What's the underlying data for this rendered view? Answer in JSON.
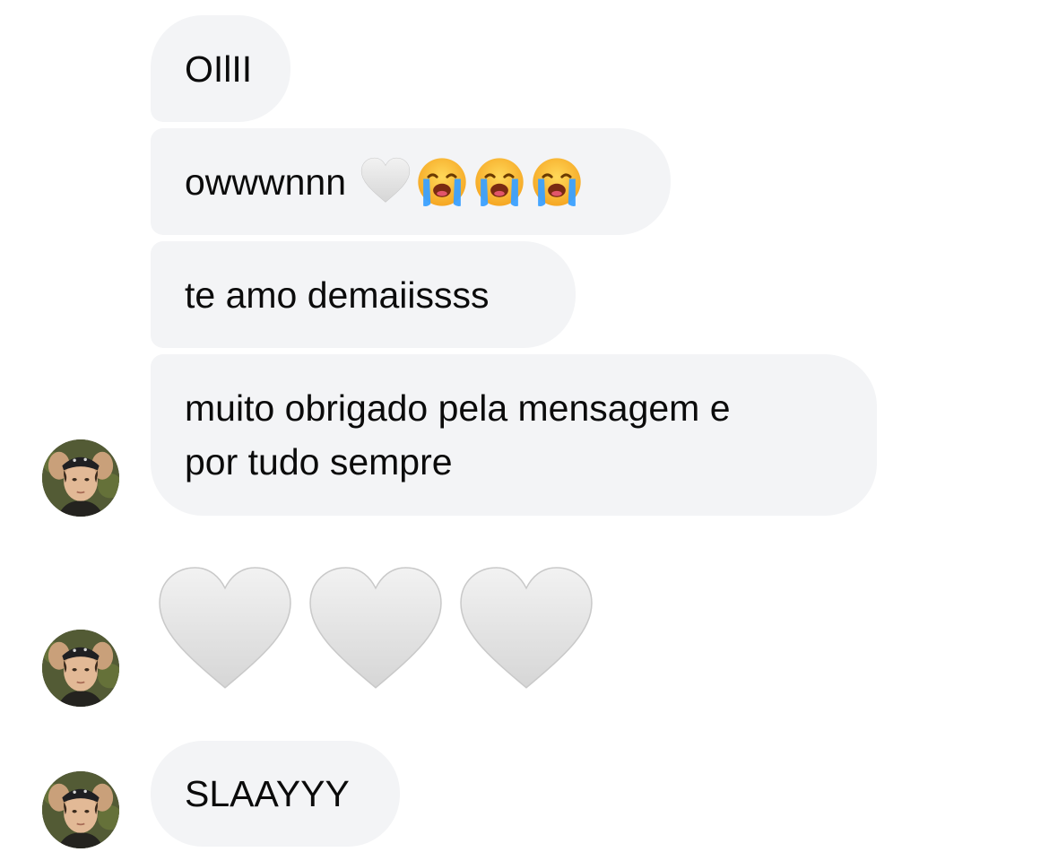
{
  "messages": [
    {
      "id": "msg-1",
      "text": "OIlII"
    },
    {
      "id": "msg-2",
      "text": "owwwnnn",
      "emojis": [
        "white-heart",
        "loudly-crying-face",
        "loudly-crying-face",
        "loudly-crying-face"
      ]
    },
    {
      "id": "msg-3",
      "text": "te amo demaiissss"
    },
    {
      "id": "msg-4",
      "line1": "muito obrigado pela mensagem e",
      "line2": "por tudo sempre"
    },
    {
      "id": "msg-5",
      "emojis": [
        "white-heart",
        "white-heart",
        "white-heart"
      ]
    },
    {
      "id": "msg-6",
      "text": "SLAAYYY"
    }
  ],
  "colors": {
    "bubble_bg": "#f3f4f6",
    "text": "#0b0b0b",
    "page_bg": "#ffffff",
    "heart_fill": "#e6e6e6",
    "cry_face": "#f7b928"
  },
  "icons": {
    "avatar": "contact-avatar",
    "heart": "white-heart-emoji",
    "cry": "loudly-crying-face-emoji"
  }
}
